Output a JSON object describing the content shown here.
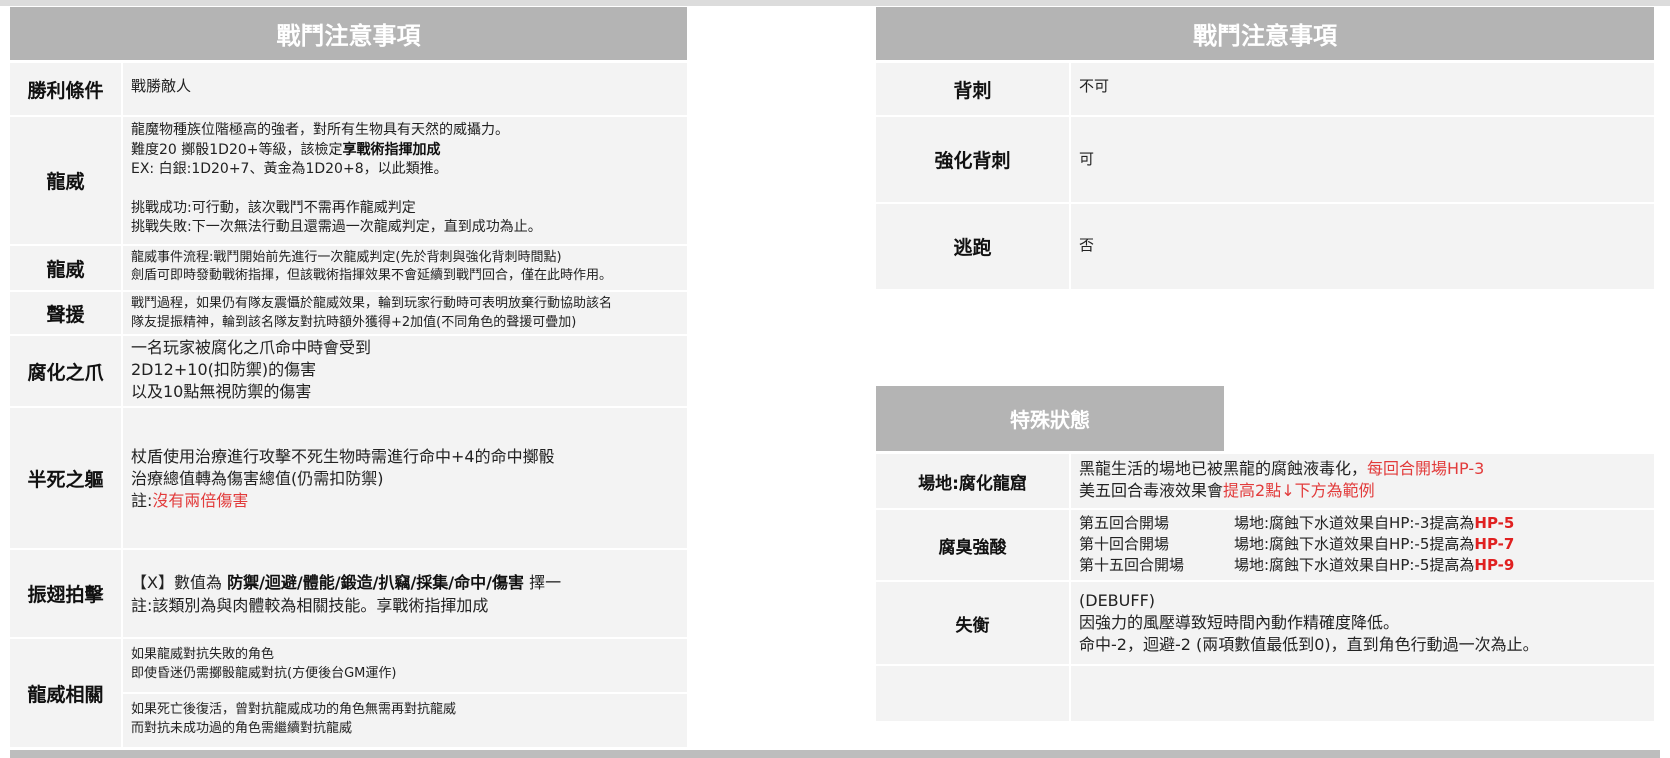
{
  "left": {
    "header": "戰鬥注意事項",
    "rows": [
      {
        "label": "勝利條件",
        "lines": [
          "戰勝敵人"
        ]
      },
      {
        "label": "龍威",
        "lines": [
          "龍魔物種族位階極高的強者，對所有生物具有天然的威攝力。",
          {
            "pre": "難度20 擲骰1D20+等級，該檢定",
            "bold": "享戰術指揮加成"
          },
          "EX: 白銀:1D20+7、黃金為1D20+8，以此類推。",
          "",
          "挑戰成功:可行動，該次戰鬥不需再作龍威判定",
          "挑戰失敗:下一次無法行動且還需過一次龍威判定，直到成功為止。"
        ]
      },
      {
        "label": "龍威",
        "lines": [
          "龍威事件流程:戰鬥開始前先進行一次龍威判定(先於背刺與強化背刺時間點)",
          "劍盾可即時發動戰術指揮，但該戰術指揮效果不會延續到戰鬥回合，僅在此時作用。"
        ]
      },
      {
        "label": "聲援",
        "lines": [
          "戰鬥過程，如果仍有隊友震懾於龍威效果，輪到玩家行動時可表明放棄行動協助該名",
          "隊友提振精神，輪到該名隊友對抗時額外獲得+2加值(不同角色的聲援可疊加)"
        ]
      },
      {
        "label": "腐化之爪",
        "lines": [
          "一名玩家被腐化之爪命中時會受到",
          "2D12+10(扣防禦)的傷害",
          "以及10點無視防禦的傷害"
        ]
      },
      {
        "label": "半死之軀",
        "lines": [
          "杖盾使用治療進行攻擊不死生物時需進行命中+4的命中擲骰",
          "治療總值轉為傷害總值(仍需扣防禦)",
          {
            "pre": "註:",
            "red": "沒有兩倍傷害"
          }
        ]
      },
      {
        "label": "振翅拍擊",
        "lines": [
          {
            "pre": "【X】數值為 ",
            "bold": "防禦/迴避/體能/鍛造/扒竊/採集/命中/傷害",
            "post": " 擇一"
          },
          "註:該類別為與肉體較為相關技能。享戰術指揮加成"
        ]
      },
      {
        "label": "龍威相關",
        "lines_a": [
          "如果龍威對抗失敗的角色",
          "即使昏迷仍需擲骰龍威對抗(方便後台GM運作)"
        ],
        "lines_b": [
          "如果死亡後復活，曾對抗龍威成功的角色無需再對抗龍威",
          "而對抗未成功過的角色需繼續對抗龍威"
        ]
      }
    ]
  },
  "right": {
    "header": "戰鬥注意事項",
    "rows": [
      {
        "label": "背刺",
        "value": "不可"
      },
      {
        "label": "強化背刺",
        "value": "可"
      },
      {
        "label": "逃跑",
        "value": "否"
      }
    ],
    "special_header": "特殊狀態",
    "special_rows": [
      {
        "label": "場地:腐化龍窟",
        "lines": [
          {
            "pre": "黑龍生活的場地已被黑龍的腐蝕液毒化，",
            "red": "每回合開場HP-3"
          },
          {
            "pre": "美五回合毒液效果會",
            "red": "提高2點↓下方為範例"
          }
        ]
      },
      {
        "label": "腐臭強酸",
        "lines": [
          {
            "a": "第五回合開場",
            "b": "場地:腐蝕下水道效果自HP:-3提高為",
            "hp": "HP-5"
          },
          {
            "a": "第十回合開場",
            "b": "場地:腐蝕下水道效果自HP:-5提高為",
            "hp": "HP-7"
          },
          {
            "a": "第十五回合開場",
            "b": "場地:腐蝕下水道效果自HP:-5提高為",
            "hp": "HP-9"
          }
        ]
      },
      {
        "label": "失衡",
        "lines": [
          "(DEBUFF)",
          "因強力的風壓導致短時間內動作精確度降低。",
          "命中-2，迴避-2 (兩項數值最低到0)，直到角色行動過一次為止。"
        ]
      },
      {
        "label": "",
        "lines": []
      }
    ]
  }
}
